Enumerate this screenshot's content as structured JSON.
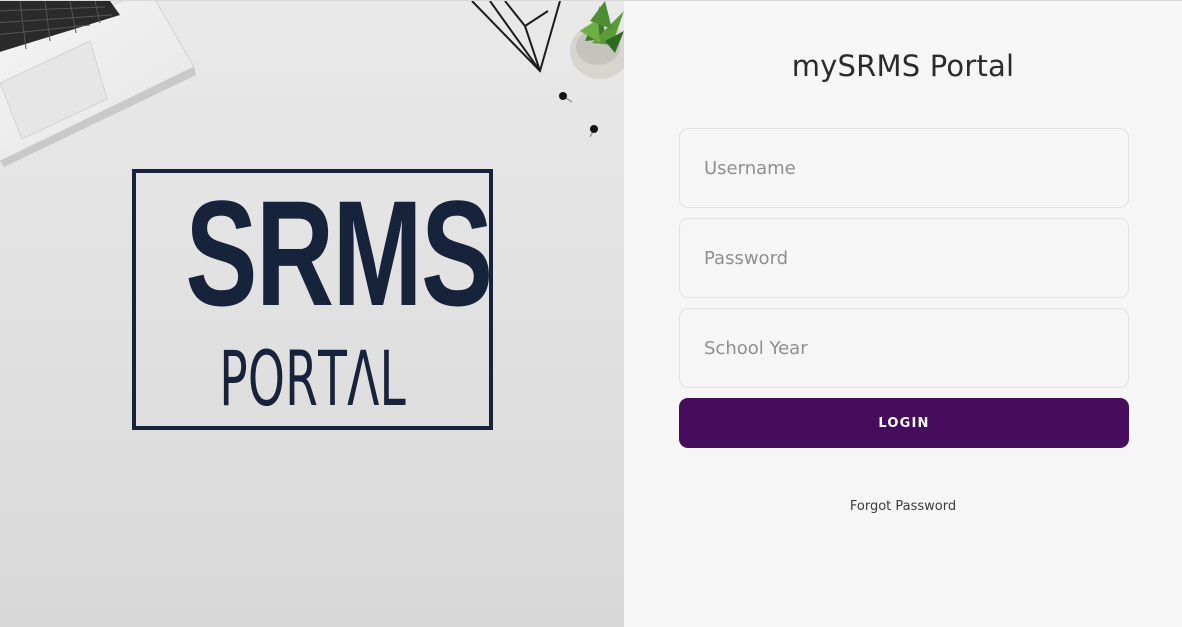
{
  "hero": {
    "logo_main": "SRMS",
    "logo_sub_letters": [
      "P",
      "O",
      "R",
      "T",
      "Λ",
      "L"
    ],
    "brand_color": "#17223b"
  },
  "login": {
    "title": "mySRMS Portal",
    "username_placeholder": "Username",
    "password_placeholder": "Password",
    "school_year_placeholder": "School Year",
    "login_label": "LOGIN",
    "forgot_label": "Forgot Password",
    "button_color": "#470d5d"
  }
}
